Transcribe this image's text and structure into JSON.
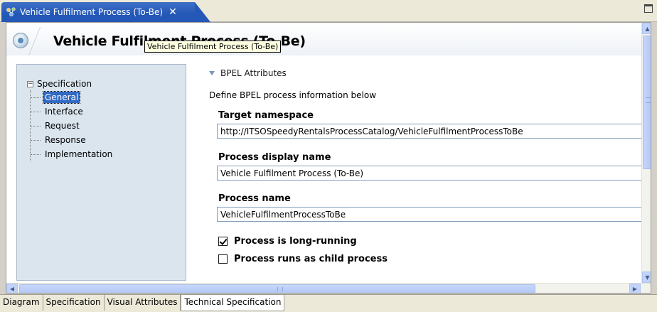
{
  "editor_tab": {
    "title": "Vehicle Fulfilment Process (To-Be)",
    "close_glyph": "✕",
    "icon": "process-icon"
  },
  "header": {
    "title": "Vehicle Fulfilment Process (To-Be)",
    "icon": "process-globe-icon"
  },
  "tooltip": {
    "text": "Vehicle Fulfilment Process (To-Be)"
  },
  "nav_tree": {
    "root_label": "Specification",
    "expander_glyph": "−",
    "items": [
      {
        "label": "General",
        "selected": true
      },
      {
        "label": "Interface",
        "selected": false
      },
      {
        "label": "Request",
        "selected": false
      },
      {
        "label": "Response",
        "selected": false
      },
      {
        "label": "Implementation",
        "selected": false
      }
    ]
  },
  "section": {
    "title": "BPEL Attributes",
    "description": "Define BPEL process information below"
  },
  "fields": {
    "target_namespace_label": "Target namespace",
    "target_namespace_value": "http://ITSOSpeedyRentalsProcessCatalog/VehicleFulfilmentProcessToBe",
    "display_name_label": "Process display name",
    "display_name_value": "Vehicle Fulfilment Process (To-Be)",
    "process_name_label": "Process name",
    "process_name_value": "VehicleFulfilmentProcessToBe"
  },
  "checkboxes": {
    "long_running_label": "Process is long-running",
    "long_running_checked": true,
    "child_process_label": "Process runs as child process",
    "child_process_checked": false
  },
  "scrollbars": {
    "up_glyph": "▲",
    "down_glyph": "▼",
    "left_glyph": "◀",
    "right_glyph": "▶"
  },
  "bottom_tabs": [
    {
      "label": "Diagram",
      "active": false
    },
    {
      "label": "Specification",
      "active": false
    },
    {
      "label": "Visual Attributes",
      "active": false
    },
    {
      "label": "Technical Specification",
      "active": true
    }
  ],
  "colors": {
    "tab_active": "#2458b7",
    "nav_background": "#dae5ee",
    "selection": "#316ac5",
    "tooltip_background": "#ffffe1"
  }
}
